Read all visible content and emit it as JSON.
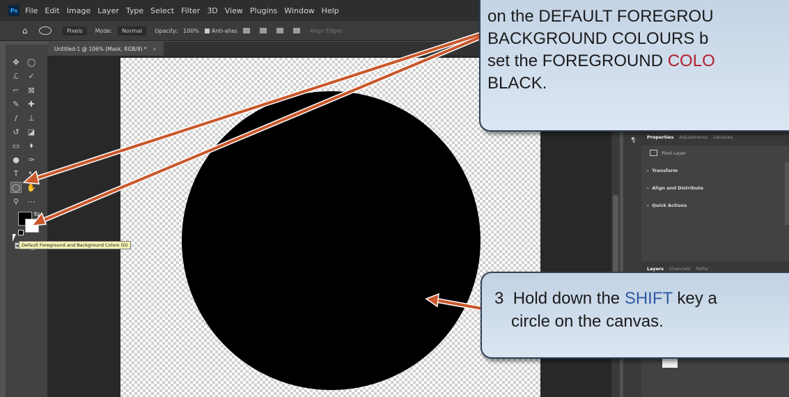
{
  "app": {
    "logo": "Ps",
    "menu": [
      "File",
      "Edit",
      "Image",
      "Layer",
      "Type",
      "Select",
      "Filter",
      "3D",
      "View",
      "Plugins",
      "Window",
      "Help"
    ]
  },
  "options_bar": {
    "mode_dropdown": "Pixels",
    "mode_label": "Mode:",
    "mode_value": "Normal",
    "opacity_label": "Opacity:",
    "opacity_value": "100%",
    "antialias_label": "Anti-alias",
    "align_edges_label": "Align Edges"
  },
  "document_tab": {
    "title": "Untitled-1 @ 106% (Mask, RGB/8) *",
    "close": "×"
  },
  "tooltip": "Default Foreground and Background Colors (D)",
  "properties_panel": {
    "tabs": [
      "Properties",
      "Adjustments",
      "Libraries"
    ],
    "layer_type": "Pixel Layer",
    "sections": [
      "Transform",
      "Align and Distribute",
      "Quick Actions"
    ]
  },
  "layers_panel": {
    "tabs": [
      "Layers",
      "Channels",
      "Paths"
    ]
  },
  "callout_top": {
    "line1": "on the DEFAULT FOREGROU",
    "line2": "BACKGROUND COLOURS b",
    "line3_pre": "set the FOREGROUND ",
    "line3_highlight": "COLO",
    "line4": "BLACK."
  },
  "callout_bottom": {
    "step_number": "3",
    "line1_pre": "Hold down the ",
    "line1_highlight": "SHIFT",
    "line1_post": " key a",
    "line2": "circle on the canvas."
  },
  "colors": {
    "arrow": "#c9572b",
    "callout_fill": "#cfdcea",
    "callout_border": "#2f3f57",
    "highlight_blue": "#2d5aa3",
    "highlight_red": "#b21f2a"
  }
}
